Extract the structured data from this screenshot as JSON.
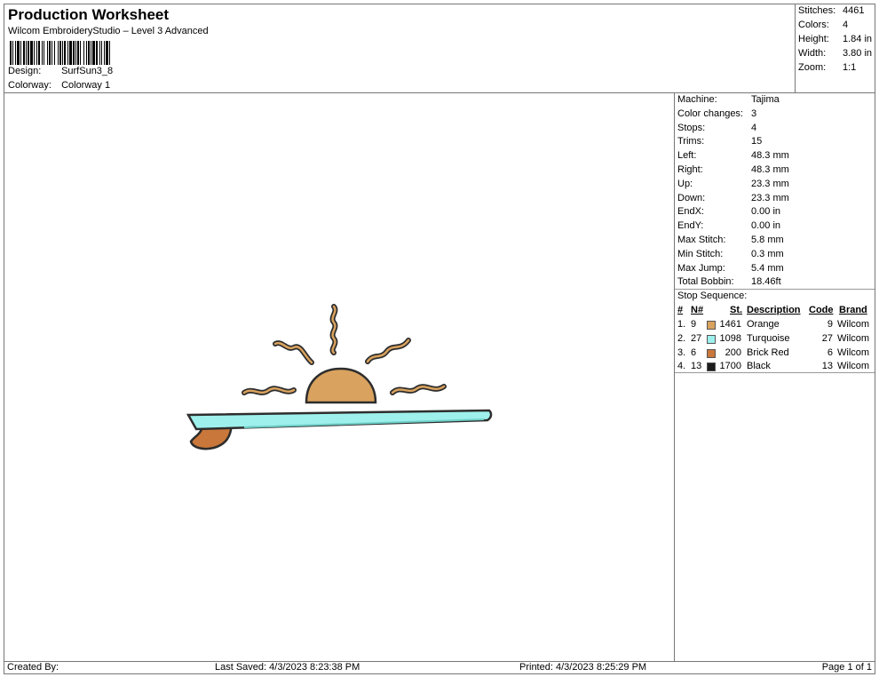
{
  "header": {
    "title": "Production Worksheet",
    "subtitle": "Wilcom EmbroideryStudio – Level 3 Advanced",
    "design_label": "Design:",
    "design_value": "SurfSun3_8",
    "colorway_label": "Colorway:",
    "colorway_value": "Colorway 1"
  },
  "summary": [
    {
      "label": "Stitches:",
      "value": "4461"
    },
    {
      "label": "Colors:",
      "value": "4"
    },
    {
      "label": "Height:",
      "value": "1.84 in"
    },
    {
      "label": "Width:",
      "value": "3.80 in"
    },
    {
      "label": "Zoom:",
      "value": "1:1"
    }
  ],
  "machine_info": [
    {
      "label": "Machine:",
      "value": "Tajima"
    },
    {
      "label": "Color changes:",
      "value": "3"
    },
    {
      "label": "Stops:",
      "value": "4"
    },
    {
      "label": "Trims:",
      "value": "15"
    },
    {
      "label": "Left:",
      "value": "48.3 mm"
    },
    {
      "label": "Right:",
      "value": "48.3 mm"
    },
    {
      "label": "Up:",
      "value": "23.3 mm"
    },
    {
      "label": "Down:",
      "value": "23.3 mm"
    },
    {
      "label": "EndX:",
      "value": "0.00 in"
    },
    {
      "label": "EndY:",
      "value": "0.00 in"
    },
    {
      "label": "Max Stitch:",
      "value": "5.8 mm"
    },
    {
      "label": "Min Stitch:",
      "value": "0.3 mm"
    },
    {
      "label": "Max Jump:",
      "value": "5.4 mm"
    },
    {
      "label": "Total Bobbin:",
      "value": "18.46ft"
    }
  ],
  "stop_sequence": {
    "title": "Stop Sequence:",
    "headers": {
      "num": "#",
      "n": "N#",
      "st": "St.",
      "desc": "Description",
      "code": "Code",
      "brand": "Brand"
    },
    "rows": [
      {
        "num": "1.",
        "n": "9",
        "st": "1461",
        "desc": "Orange",
        "code": "9",
        "brand": "Wilcom",
        "color": "#d9a25e"
      },
      {
        "num": "2.",
        "n": "27",
        "st": "1098",
        "desc": "Turquoise",
        "code": "27",
        "brand": "Wilcom",
        "color": "#9ef0ec"
      },
      {
        "num": "3.",
        "n": "6",
        "st": "200",
        "desc": "Brick Red",
        "code": "6",
        "brand": "Wilcom",
        "color": "#c9773a"
      },
      {
        "num": "4.",
        "n": "13",
        "st": "1700",
        "desc": "Black",
        "code": "13",
        "brand": "Wilcom",
        "color": "#1c1c1c"
      }
    ]
  },
  "footer": {
    "created_by": "Created By:",
    "last_saved": "Last Saved: 4/3/2023 8:23:38 PM",
    "printed": "Printed: 4/3/2023 8:25:29 PM",
    "page": "Page 1 of 1"
  }
}
